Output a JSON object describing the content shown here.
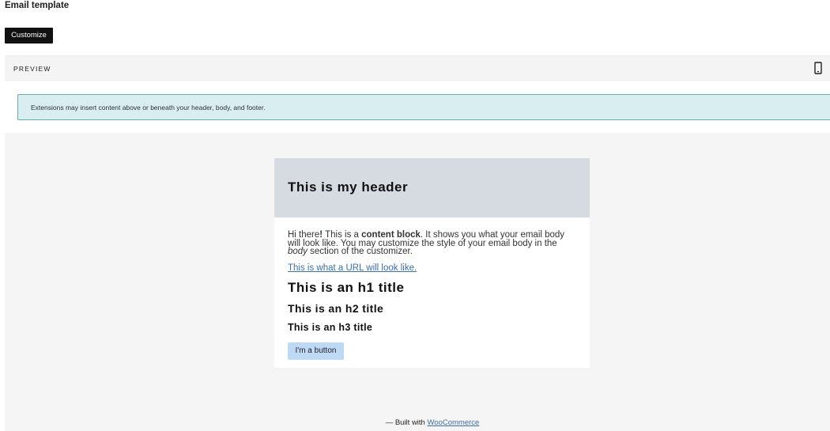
{
  "page": {
    "title": "Email template",
    "customize_label": "Customize"
  },
  "preview": {
    "label": "PREVIEW",
    "device_icon": "mobile-device-icon"
  },
  "notice": {
    "text": "Extensions may insert content above or beneath your header, body, and footer."
  },
  "email": {
    "header_title": "This is my header",
    "body": {
      "greeting": "Hi there",
      "excl": "!",
      "part1": " This is a ",
      "bold": "content block",
      "part2": ". It shows you what your email body will look like. You may customize the style of your email body in the ",
      "italic": "body",
      "part3": " section of the customizer."
    },
    "link_text": "This is what a URL will look like.",
    "h1": "This is an h1 title",
    "h2": "This is an h2 title",
    "h3": "This is an h3 title",
    "button_label": "I'm a button"
  },
  "footer": {
    "prefix": "— Built with ",
    "link": "WooCommerce"
  },
  "colors": {
    "header_bg": "#d5dbe1",
    "notice_bg": "#d9eef0",
    "notice_border": "#6aa7b0",
    "button_bg": "#bed9f5",
    "link": "#3c6e9e",
    "canvas_bg": "#f5f5f5"
  }
}
